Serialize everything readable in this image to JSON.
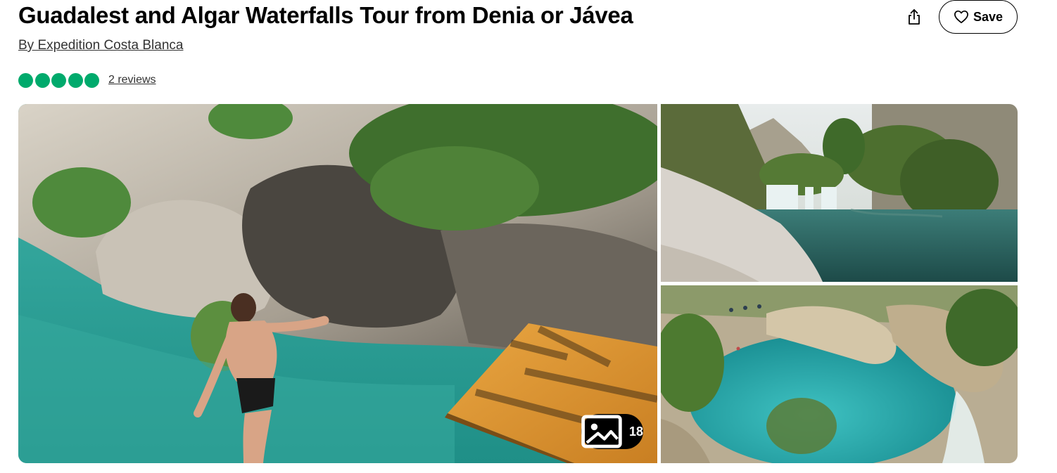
{
  "header": {
    "title": "Guadalest and Algar Waterfalls Tour from Denia or Jávea",
    "byline": "By Expedition Costa Blanca",
    "rating_bubbles": 5,
    "reviews_link": "2 reviews"
  },
  "actions": {
    "share_icon": "share-icon",
    "save_label": "Save",
    "save_icon": "heart-icon"
  },
  "gallery": {
    "photo_count": "18",
    "photo_count_icon": "image-icon",
    "photos": [
      {
        "name": "main-photo"
      },
      {
        "name": "waterfall-photo"
      },
      {
        "name": "pool-photo"
      }
    ]
  },
  "colors": {
    "rating_green": "#00aa6c",
    "text": "#000000",
    "water": "#2aa59a"
  }
}
